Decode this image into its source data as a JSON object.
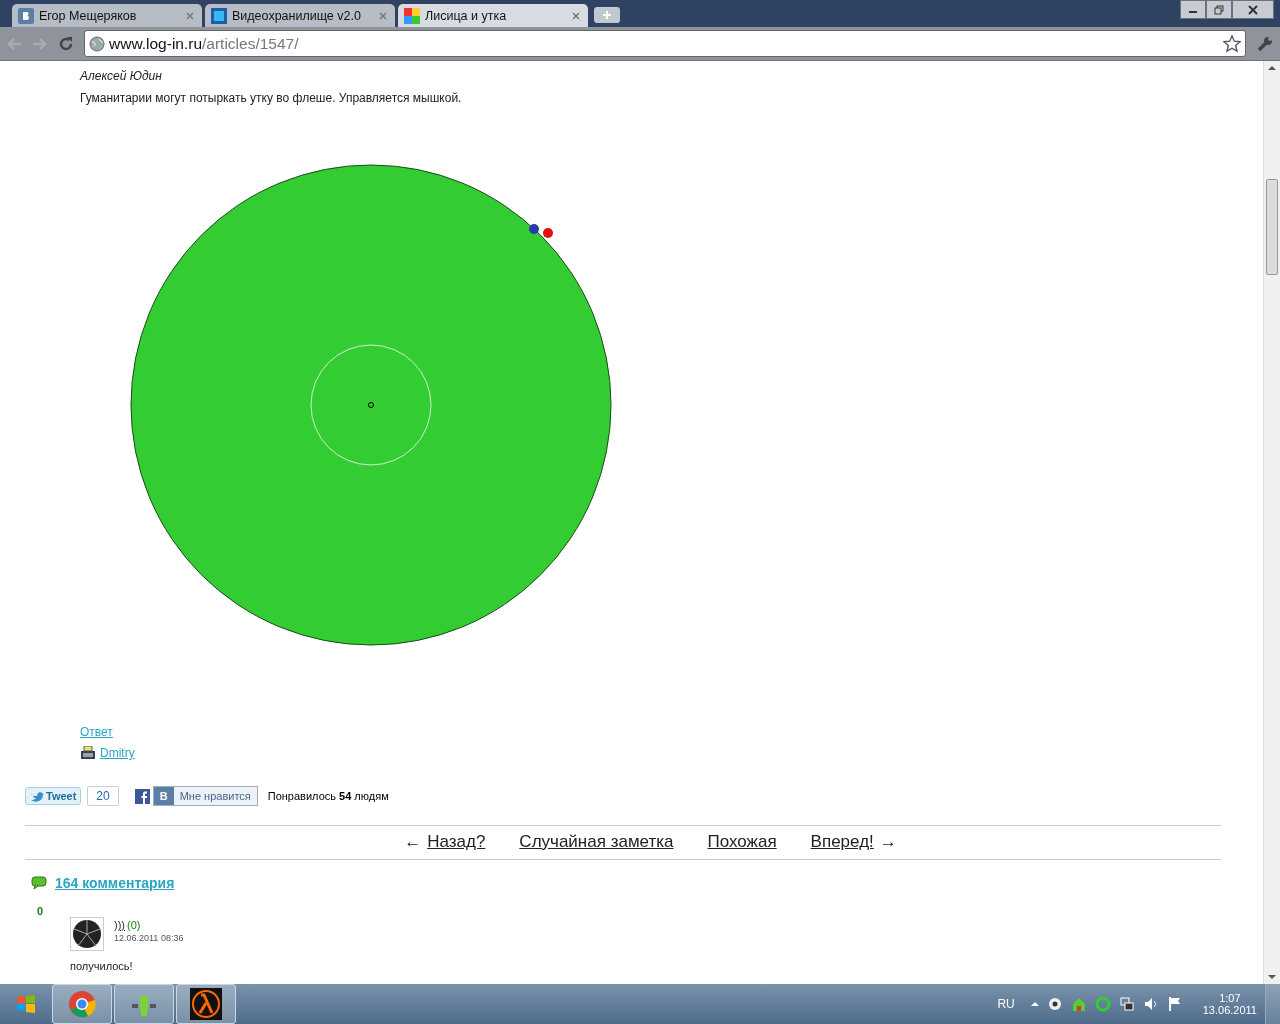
{
  "tabs": [
    {
      "title": "Егор Мещеряков",
      "selected": false
    },
    {
      "title": "Видеохранилище v2.0",
      "selected": false
    },
    {
      "title": "Лисица и утка",
      "selected": true
    }
  ],
  "address": {
    "host": "www.log-in.ru",
    "path": "/articles/1547/"
  },
  "article": {
    "author": "Алексей Юдин",
    "description": "Гуманитарии могут потыркать утку во флеше. Управляется мышкой.",
    "reply_link": "Ответ",
    "user_link": "Dmitry"
  },
  "share": {
    "tweet": "Tweet",
    "tweet_count": "20",
    "vk_letter": "В",
    "like": "Мне нравится",
    "liked": "Понравилось **54** людям"
  },
  "nav": [
    {
      "arrow_before": "←",
      "label": "Назад?"
    },
    {
      "label": "Случайная заметка"
    },
    {
      "label": "Похожая"
    },
    {
      "label": "Вперед!",
      "arrow_after": "→"
    }
  ],
  "comments": {
    "count_link": "164 комментария",
    "items": [
      {
        "score": "0",
        "name": ")))",
        "rating": "(0)",
        "date": "12.06.2011 08:36",
        "text": "получилось!"
      }
    ]
  },
  "taskbar": {
    "apps": [
      {
        "kind": "chrome"
      },
      {
        "kind": "green"
      },
      {
        "kind": "lambda"
      }
    ],
    "language": "RU",
    "time": "1:07",
    "date": "13.06.2011"
  }
}
